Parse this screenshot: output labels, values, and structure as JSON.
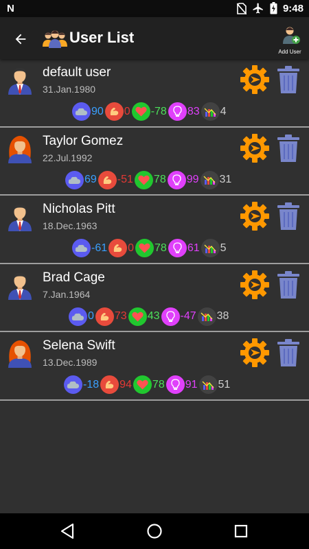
{
  "status": {
    "time": "9:48"
  },
  "header": {
    "title": "User List",
    "add_user_label": "Add User"
  },
  "colors": {
    "sleep": "#5b5bf0",
    "strength": "#e84b3c",
    "health": "#21c72f",
    "idea": "#e040fb",
    "gear": "#ff9800",
    "trash": "#7986cb"
  },
  "users": [
    {
      "name": "default user",
      "date": "31.Jan.1980",
      "avatar": "male-avatar-icon",
      "sleep": "90",
      "strength": "0",
      "health": "-78",
      "idea": "83",
      "total": "4"
    },
    {
      "name": "Taylor Gomez",
      "date": "22.Jul.1992",
      "avatar": "female-avatar-icon",
      "sleep": "69",
      "strength": "-51",
      "health": "78",
      "idea": "99",
      "total": "31"
    },
    {
      "name": "Nicholas Pitt",
      "date": "18.Dec.1963",
      "avatar": "male-avatar-icon",
      "sleep": "-61",
      "strength": "0",
      "health": "78",
      "idea": "61",
      "total": "5"
    },
    {
      "name": "Brad Cage",
      "date": "7.Jan.1964",
      "avatar": "male-avatar-icon",
      "sleep": "0",
      "strength": "73",
      "health": "43",
      "idea": "-47",
      "total": "38"
    },
    {
      "name": "Selena Swift",
      "date": "13.Dec.1989",
      "avatar": "female-avatar-icon",
      "sleep": "-18",
      "strength": "94",
      "health": "78",
      "idea": "91",
      "total": "51"
    }
  ]
}
